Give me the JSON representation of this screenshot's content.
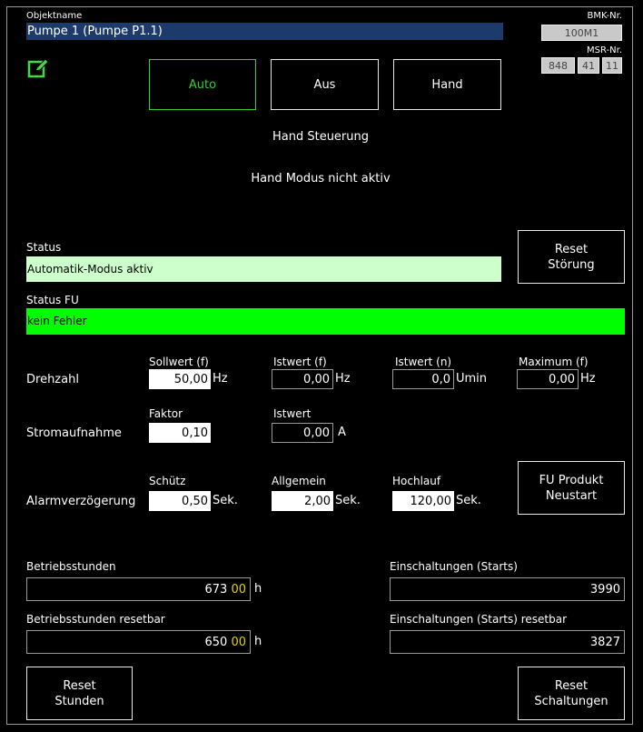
{
  "header": {
    "objektname_label": "Objektname",
    "objektname_value": "Pumpe 1 (Pumpe P1.1)",
    "bmk_label": "BMK-Nr.",
    "bmk_value": "100M1",
    "msr_label": "MSR-Nr.",
    "msr_values": [
      "848",
      "41",
      "11"
    ]
  },
  "icons": {
    "edit": "pencil-edit-icon"
  },
  "modes": {
    "auto": "Auto",
    "aus": "Aus",
    "hand": "Hand",
    "active": "auto"
  },
  "hand": {
    "title": "Hand Steuerung",
    "status": "Hand Modus nicht aktiv"
  },
  "status": {
    "label": "Status",
    "value": "Automatik-Modus aktiv",
    "reset_line1": "Reset",
    "reset_line2": "Störung",
    "fu_label": "Status FU",
    "fu_value": "kein Fehler"
  },
  "colors": {
    "status_bg": "#ccffcc",
    "fu_bg": "#00ff00",
    "active_mode": "#2fd12f",
    "name_bg": "#1d3b6a",
    "hours_fraction": "#e6d200"
  },
  "drehzahl": {
    "label": "Drehzahl",
    "sollwert_label": "Sollwert (f)",
    "sollwert_value": "50,00",
    "sollwert_unit": "Hz",
    "istwert_f_label": "Istwert (f)",
    "istwert_f_value": "0,00",
    "istwert_f_unit": "Hz",
    "istwert_n_label": "Istwert (n)",
    "istwert_n_value": "0,0",
    "istwert_n_unit": "Umin",
    "maximum_label": "Maximum (f)",
    "maximum_value": "0,00",
    "maximum_unit": "Hz"
  },
  "strom": {
    "label": "Stromaufnahme",
    "faktor_label": "Faktor",
    "faktor_value": "0,10",
    "istwert_label": "Istwert",
    "istwert_value": "0,00",
    "istwert_unit": "A"
  },
  "alarm": {
    "label": "Alarmverzögerung",
    "schuetz_label": "Schütz",
    "schuetz_value": "0,50",
    "schuetz_unit": "Sek.",
    "allgemein_label": "Allgemein",
    "allgemein_value": "2,00",
    "allgemein_unit": "Sek.",
    "hochlauf_label": "Hochlauf",
    "hochlauf_value": "120,00",
    "hochlauf_unit": "Sek.",
    "fu_btn_line1": "FU Produkt",
    "fu_btn_line2": "Neustart"
  },
  "counters": {
    "betriebsstunden_label": "Betriebsstunden",
    "betriebsstunden_int": "673",
    "betriebsstunden_frac": "00",
    "betriebsstunden_unit": "h",
    "betriebsstunden_reset_label": "Betriebsstunden resetbar",
    "betriebsstunden_reset_int": "650",
    "betriebsstunden_reset_frac": "00",
    "betriebsstunden_reset_unit": "h",
    "einschaltungen_label": "Einschaltungen (Starts)",
    "einschaltungen_value": "3990",
    "einschaltungen_reset_label": "Einschaltungen (Starts) resetbar",
    "einschaltungen_reset_value": "3827"
  },
  "reset_buttons": {
    "stunden_line1": "Reset",
    "stunden_line2": "Stunden",
    "schaltungen_line1": "Reset",
    "schaltungen_line2": "Schaltungen"
  }
}
